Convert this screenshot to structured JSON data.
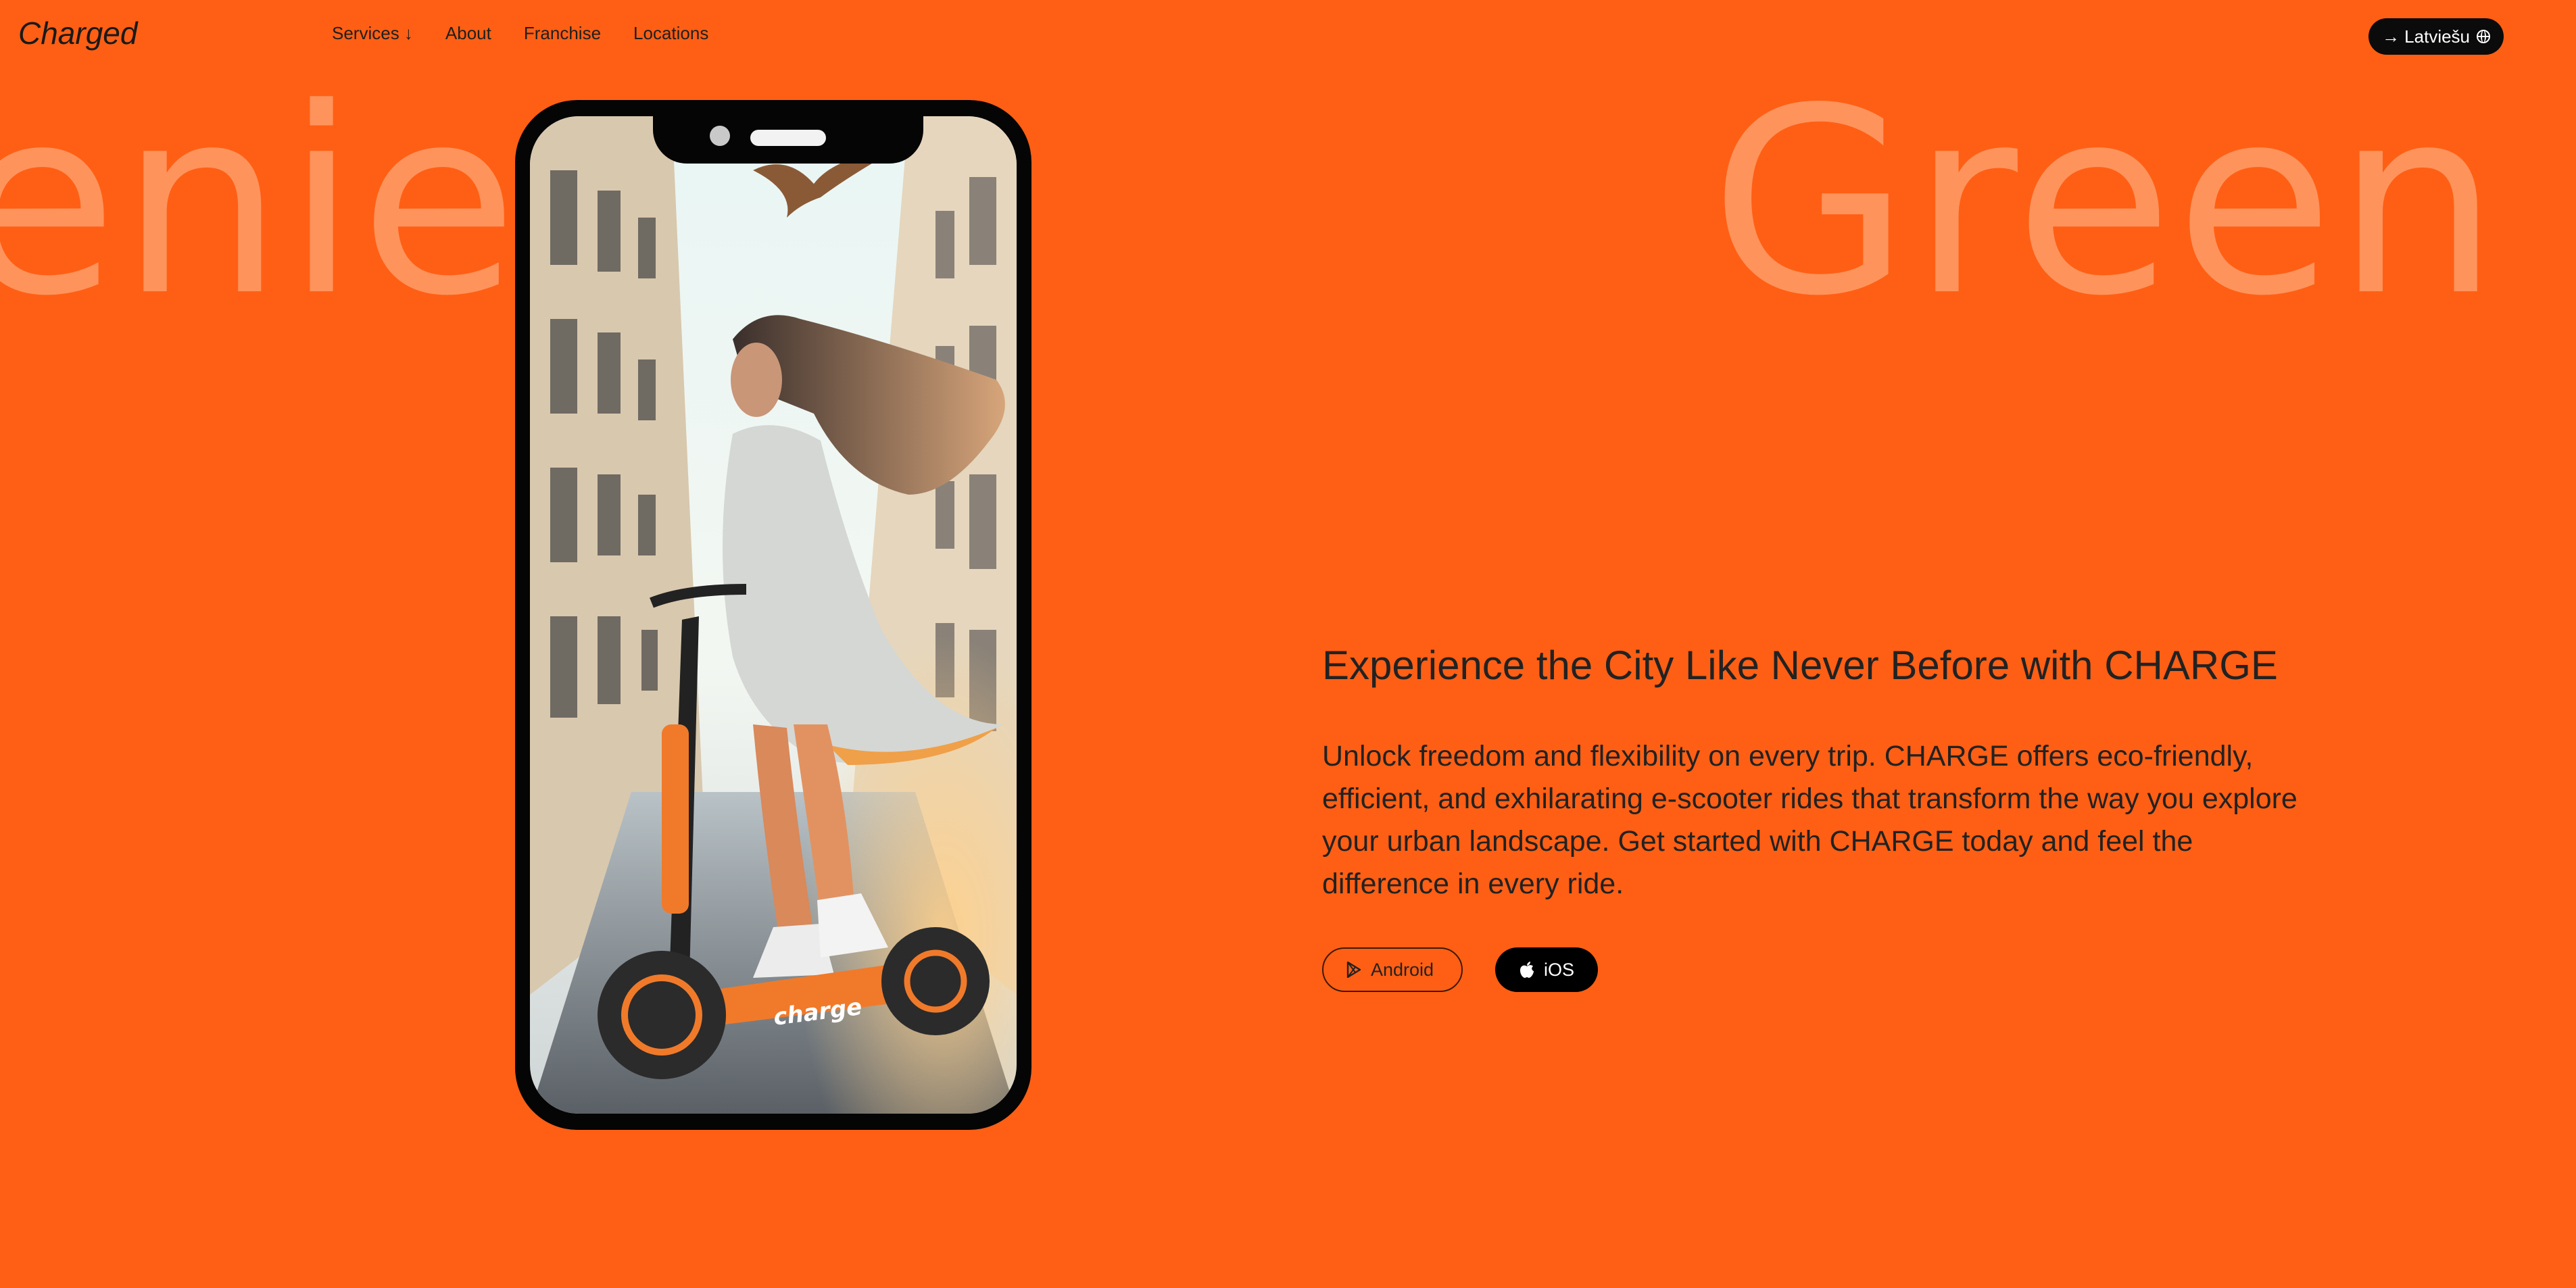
{
  "background_words": {
    "left": "enien",
    "right": "Green"
  },
  "header": {
    "logo": "Charged",
    "nav": [
      {
        "label": "Services ↓"
      },
      {
        "label": "About"
      },
      {
        "label": "Franchise"
      },
      {
        "label": "Locations"
      }
    ],
    "language_button": "→ Latviešu"
  },
  "hero": {
    "headline": "Experience the City Like Never Before with CHARGE",
    "body": "Unlock freedom and flexibility on every trip. CHARGE offers eco-friendly, efficient, and exhilarating e-scooter rides that transform the way you explore your urban landscape. Get started with CHARGE today and feel the difference in every ride.",
    "image_scooter_label": "charge",
    "buttons": {
      "android": "Android",
      "ios": "iOS"
    }
  },
  "colors": {
    "background": "#ff5f14",
    "dark": "#0b0b0b",
    "scooter_orange": "#f07a2a"
  },
  "icons": [
    "globe-icon",
    "play-store-icon",
    "apple-icon"
  ]
}
